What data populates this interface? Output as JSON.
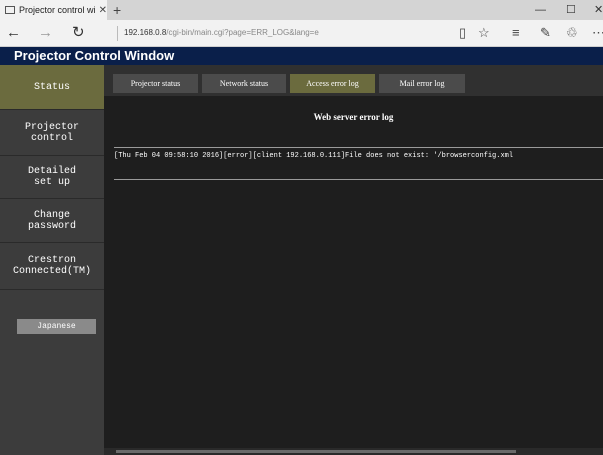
{
  "browser": {
    "tab_title": "Projector control windo",
    "tab_close": "✕",
    "new_tab": "+",
    "window_controls": {
      "minimize": "—",
      "maximize": "☐",
      "close": "✕"
    },
    "url_host": "192.168.0.8",
    "url_path": "/cgi-bin/main.cgi?page=ERR_LOG&lang=e",
    "icons": [
      "back-icon",
      "forward-icon",
      "refresh-icon",
      "reading-view-icon",
      "favorite-star-icon",
      "hub-icon",
      "web-note-icon",
      "share-icon",
      "more-icon"
    ]
  },
  "app": {
    "title": "Projector Control Window"
  },
  "sidebar": {
    "items": [
      {
        "label": "Status",
        "active": true
      },
      {
        "label": "Projector\ncontrol",
        "active": false
      },
      {
        "label": "Detailed\nset up",
        "active": false
      },
      {
        "label": "Change\npassword",
        "active": false
      },
      {
        "label": "Crestron\nConnected(TM)",
        "active": false
      }
    ],
    "language_button": "Japanese"
  },
  "tabs": [
    {
      "label": "Projector status",
      "active": false
    },
    {
      "label": "Network status",
      "active": false
    },
    {
      "label": "Access error log",
      "active": true
    },
    {
      "label": "Mail error log",
      "active": false
    }
  ],
  "log": {
    "title": "Web server error log",
    "entries": [
      "[Thu Feb 04 09:58:10 2016][error][client 192.168.0.111]File does not exist: '/browserconfig.xml"
    ]
  },
  "colors": {
    "app_title_bg": "#0a1f4a",
    "active_item_bg": "#6b6b3e",
    "sidebar_bg": "#3c3c3c",
    "content_bg": "#1e1e1e"
  }
}
